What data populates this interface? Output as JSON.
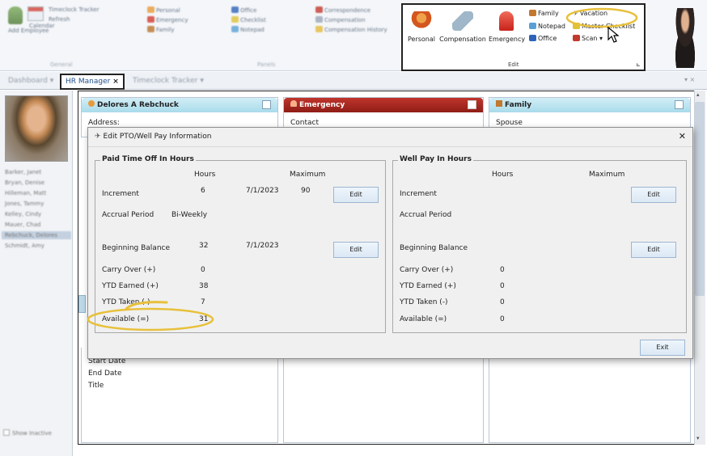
{
  "ribbon": {
    "general": {
      "add_employee": "Add Employee",
      "calendar": "Calendar",
      "timeclock_tracker": "Timeclock Tracker",
      "refresh": "Refresh",
      "group_label": "General"
    },
    "panels": {
      "items": [
        "Personal",
        "Emergency",
        "Family",
        "Office",
        "Checklist",
        "Notepad",
        "Correspondence",
        "Compensation",
        "Compensation History"
      ],
      "group_label": "Panels"
    },
    "edit": {
      "personal": "Personal",
      "compensation": "Compensation",
      "emergency": "Emergency",
      "family": "Family",
      "vacation": "Vacation",
      "notepad": "Notepad",
      "master_checklist": "Master Checklist",
      "office": "Office",
      "scan": "Scan",
      "group_label": "Edit"
    }
  },
  "tabs": {
    "dashboard": "Dashboard",
    "hr_manager": "HR Manager",
    "timeclock_tracker": "Timeclock Tracker"
  },
  "left_pane": {
    "employees": [
      "Barker, Janet",
      "Bryan, Denise",
      "Hilleman, Matt",
      "Jones, Tammy",
      "Kelley, Cindy",
      "Mauer, Chad",
      "Rebchuck, Delores",
      "Schmidt, Amy"
    ],
    "show_inactive": "Show Inactive"
  },
  "cards": {
    "employee": {
      "title": "Delores A Rebchuck",
      "field": "Address:"
    },
    "emergency": {
      "title": "Emergency",
      "field": "Contact"
    },
    "family": {
      "title": "Family",
      "field": "Spouse"
    },
    "lower_fields": [
      "Start Date",
      "End Date",
      "Title"
    ]
  },
  "dialog": {
    "title": "Edit PTO/Well Pay Information",
    "pto": {
      "legend": "Paid Time Off In Hours",
      "col_hours": "Hours",
      "col_maximum": "Maximum",
      "increment_label": "Increment",
      "increment_hours": "6",
      "increment_date": "7/1/2023",
      "increment_max": "90",
      "accrual_label": "Accrual Period",
      "accrual_value": "Bi-Weekly",
      "beginning_label": "Beginning Balance",
      "beginning_hours": "32",
      "beginning_date": "7/1/2023",
      "carry_label": "Carry Over (+)",
      "carry_value": "0",
      "earned_label": "YTD Earned (+)",
      "earned_value": "38",
      "taken_label": "YTD Taken (-)",
      "taken_value": "7",
      "available_label": "Available (=)",
      "available_value": "31",
      "edit_label": "Edit"
    },
    "well": {
      "legend": "Well Pay In Hours",
      "col_hours": "Hours",
      "col_maximum": "Maximum",
      "increment_label": "Increment",
      "accrual_label": "Accrual Period",
      "beginning_label": "Beginning Balance",
      "carry_label": "Carry Over (+)",
      "carry_value": "0",
      "earned_label": "YTD Earned (+)",
      "earned_value": "0",
      "taken_label": "YTD Taken (-)",
      "taken_value": "0",
      "available_label": "Available (=)",
      "available_value": "0",
      "edit_label": "Edit"
    },
    "exit_label": "Exit",
    "close_glyph": "✕"
  },
  "colors": {
    "highlight": "#e8c03a",
    "accent": "#1f4e8c",
    "card_teal": "#bfe3ee",
    "card_red": "#a8201a"
  },
  "icons": [
    "vacation-icon",
    "family-icon",
    "notepad-icon",
    "office-icon",
    "scan-icon",
    "mouse-pointer-icon",
    "close-icon"
  ]
}
